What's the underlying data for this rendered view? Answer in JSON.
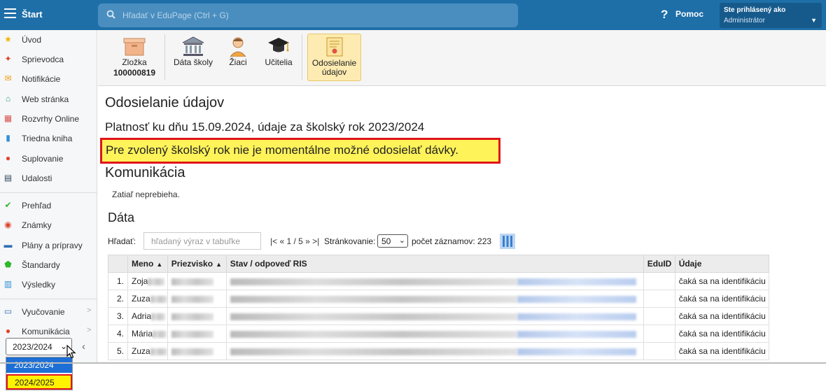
{
  "topbar": {
    "start_label": "Štart",
    "search_placeholder": "Hľadať v EduPage (Ctrl + G)",
    "help_label": "Pomoc",
    "user_line1": "Ste prihlásený ako",
    "user_line2": "Administrátor"
  },
  "sidebar": {
    "items": [
      {
        "label": "Úvod",
        "icon": "star-icon",
        "color": "#f0b400"
      },
      {
        "label": "Sprievodca",
        "icon": "wand-icon",
        "color": "#e0422e"
      },
      {
        "label": "Notifikácie",
        "icon": "envelope-icon",
        "color": "#f29b11"
      },
      {
        "label": "Web stránka",
        "icon": "home-icon",
        "color": "#2a9d8f"
      },
      {
        "label": "Rozvrhy Online",
        "icon": "grid-icon",
        "color": "#d9534f"
      },
      {
        "label": "Triedna kniha",
        "icon": "book-icon",
        "color": "#2f8fd6"
      },
      {
        "label": "Suplovanie",
        "icon": "person-icon",
        "color": "#e0422e"
      },
      {
        "label": "Udalosti",
        "icon": "calendar-icon",
        "color": "#34495e"
      },
      {
        "label": "Prehľad",
        "icon": "check-circle-icon",
        "color": "#2eb82e"
      },
      {
        "label": "Známky",
        "icon": "grade-icon",
        "color": "#e0422e"
      },
      {
        "label": "Plány a prípravy",
        "icon": "briefcase-icon",
        "color": "#2f6fb3"
      },
      {
        "label": "Štandardy",
        "icon": "shield-icon",
        "color": "#2eb82e"
      },
      {
        "label": "Výsledky",
        "icon": "bar-chart-icon",
        "color": "#2f8fd6"
      },
      {
        "label": "Vyučovanie",
        "icon": "board-icon",
        "color": "#2f6fb3"
      },
      {
        "label": "Komunikácia",
        "icon": "chat-icon",
        "color": "#e0422e"
      }
    ],
    "year_selected": "2023/2024",
    "year_options": [
      "2023/2024",
      "2024/2025"
    ]
  },
  "toolbar": {
    "items": [
      {
        "label": "Zložka",
        "sub": "100000819",
        "icon": "folder-box-icon"
      },
      {
        "label": "Dáta školy",
        "icon": "school-building-icon"
      },
      {
        "label": "Žiaci",
        "icon": "student-icon"
      },
      {
        "label": "Učitelia",
        "icon": "graduation-cap-icon"
      },
      {
        "label": "Odosielanie údajov",
        "label_line1": "Odosielanie",
        "label_line2": "údajov",
        "icon": "certificate-icon"
      }
    ]
  },
  "main": {
    "title": "Odosielanie údajov",
    "validity": "Platnosť ku dňu 15.09.2024, údaje za školský rok 2023/2024",
    "warning": "Pre zvolený školský rok nie je momentálne možné odosielať dávky.",
    "comm_title": "Komunikácia",
    "comm_text": "Zatiaľ neprebieha.",
    "data_title": "Dáta",
    "search_label": "Hľadať:",
    "search_placeholder": "hľadaný výraz v tabuľke",
    "pager": "|< « 1 / 5 » >|",
    "paging_label": "Stránkovanie:",
    "paging_value": "50",
    "count": "počet záznamov: 223",
    "columns": [
      "",
      "Meno",
      "Priezvisko",
      "Stav / odpoveď RIS",
      "EduID",
      "Údaje"
    ],
    "rows": [
      {
        "n": "1.",
        "meno": "Zoja",
        "udaje": "čaká sa na identifikáciu"
      },
      {
        "n": "2.",
        "meno": "Zuza",
        "udaje": "čaká sa na identifikáciu"
      },
      {
        "n": "3.",
        "meno": "Adria",
        "udaje": "čaká sa na identifikáciu"
      },
      {
        "n": "4.",
        "meno": "Mária",
        "udaje": "čaká sa na identifikáciu"
      },
      {
        "n": "5.",
        "meno": "Zuza",
        "udaje": "čaká sa na identifikáciu"
      }
    ]
  },
  "colors": {
    "topbar": "#1e6fa8",
    "warning_bg": "#fff35a",
    "warning_border": "#e0141c",
    "active_tool": "#fdebb2"
  }
}
